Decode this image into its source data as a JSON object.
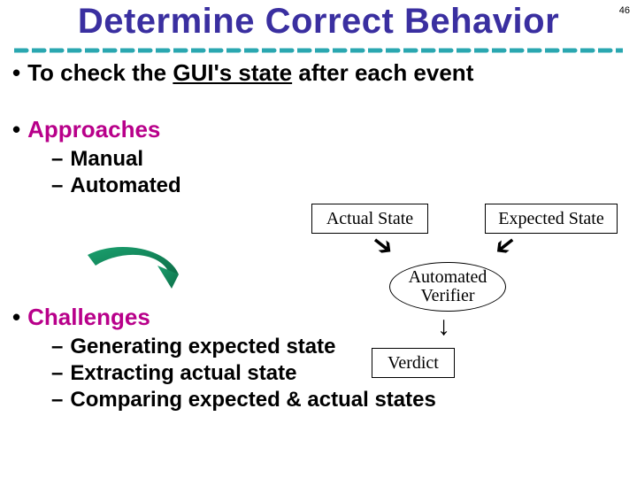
{
  "page_number": "46",
  "title": "Determine Correct Behavior",
  "bullets": {
    "b1": "To check the GUI's state after each event",
    "b1_prefix": "To check the ",
    "b1_gui": "GUI's state",
    "b1_suffix": " after each event",
    "b2": "Approaches",
    "b2_sub1": "Manual",
    "b2_sub2": "Automated",
    "b3": "Challenges",
    "b3_sub1": "Generating expected state",
    "b3_sub2": "Extracting actual state",
    "b3_sub3": "Comparing expected & actual states"
  },
  "diagram": {
    "actual": "Actual State",
    "expected": "Expected State",
    "verifier_l1": "Automated",
    "verifier_l2": "Verifier",
    "verdict": "Verdict"
  }
}
